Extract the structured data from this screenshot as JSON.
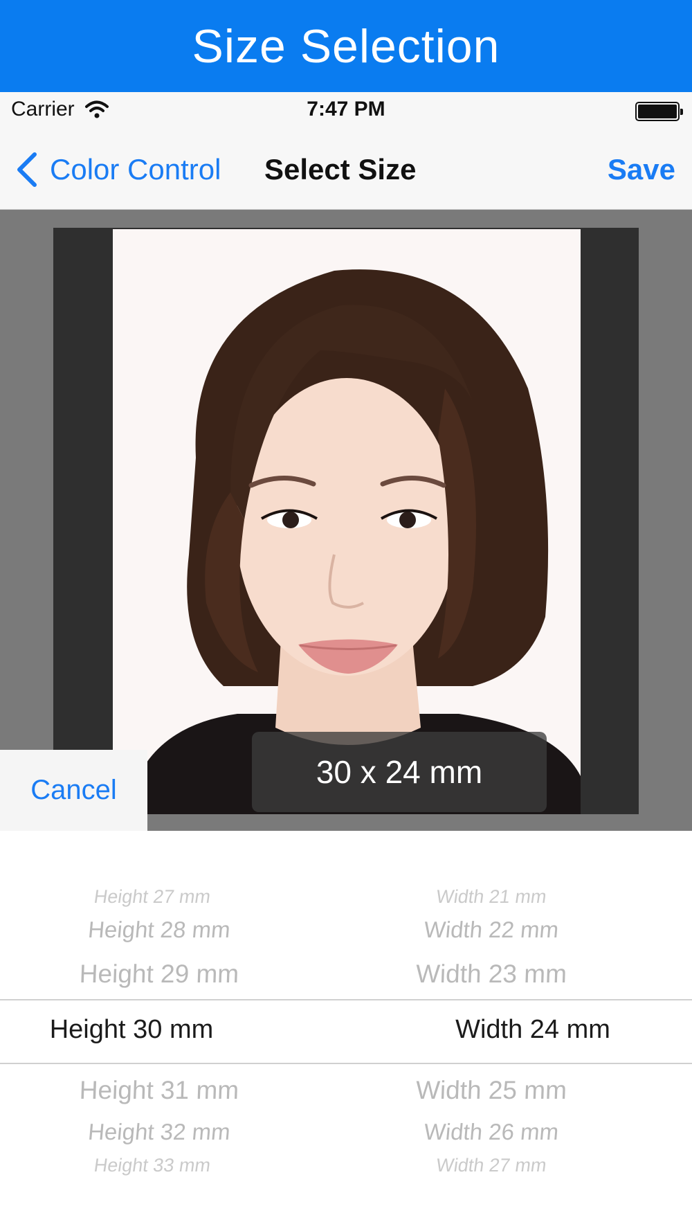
{
  "banner": {
    "title": "Size Selection"
  },
  "status_bar": {
    "carrier": "Carrier",
    "time": "7:47 PM"
  },
  "nav": {
    "back_label": "Color Control",
    "title": "Select Size",
    "save_label": "Save"
  },
  "preview": {
    "size_label": "30 x 24 mm"
  },
  "cancel_label": "Cancel",
  "picker": {
    "height_column": [
      "Height 27 mm",
      "Height 28 mm",
      "Height 29 mm",
      "Height 30 mm",
      "Height 31 mm",
      "Height 32 mm",
      "Height 33 mm"
    ],
    "width_column": [
      "Width 21 mm",
      "Width 22 mm",
      "Width 23 mm",
      "Width 24 mm",
      "Width 25 mm",
      "Width 26 mm",
      "Width 27 mm"
    ],
    "selected_height": "Height 30 mm",
    "selected_width": "Width 24 mm"
  },
  "colors": {
    "accent": "#1a7cf4",
    "banner": "#0a7cf0"
  }
}
